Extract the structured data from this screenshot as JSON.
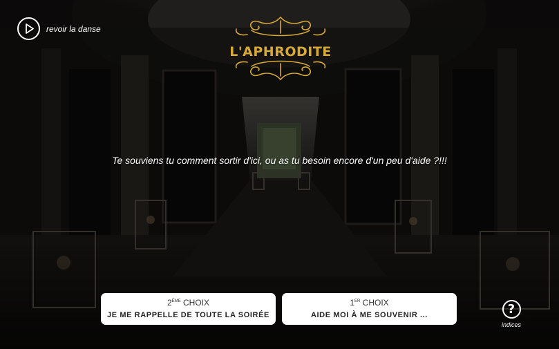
{
  "replay": {
    "label": "revoir la danse",
    "icon": "play-icon"
  },
  "logo": {
    "text": "L'APHRODITE",
    "color": "#d7a938"
  },
  "question": {
    "text": "Te souviens tu comment sortir d'ici, ou as tu besoin encore d'un peu d'aide ?!!!"
  },
  "choices": [
    {
      "number": "2",
      "suffix": "ÈME",
      "heading": " CHOIX",
      "text": "JE ME RAPPELLE DE TOUTE LA SOIRÉE"
    },
    {
      "number": "1",
      "suffix": "ER",
      "heading": " CHOIX",
      "text": "AIDE MOI À ME SOUVENIR ..."
    }
  ],
  "hints": {
    "glyph": "?",
    "label": "indices",
    "icon": "help-icon"
  }
}
